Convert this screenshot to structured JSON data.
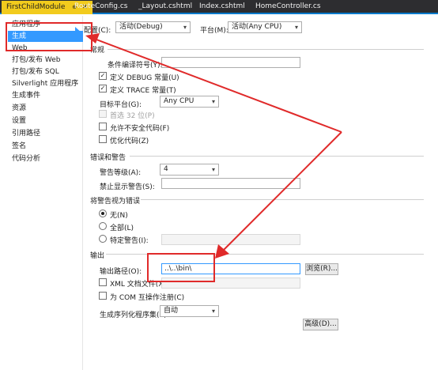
{
  "tabs": [
    {
      "label": "FirstChildModule",
      "pin": "⊕",
      "close": "✕"
    },
    {
      "label": "RouteConfig.cs"
    },
    {
      "label": "_Layout.cshtml"
    },
    {
      "label": "Index.cshtml"
    },
    {
      "label": "HomeController.cs"
    }
  ],
  "nav": {
    "items": [
      "应用程序",
      "生成",
      "Web",
      "打包/发布 Web",
      "打包/发布 SQL",
      "Silverlight 应用程序",
      "生成事件",
      "资源",
      "设置",
      "引用路径",
      "签名",
      "代码分析"
    ],
    "selected_index": 1
  },
  "config_row": {
    "config_label": "配置(C):",
    "config_value": "活动(Debug)",
    "platform_label": "平台(M):",
    "platform_value": "活动(Any CPU)"
  },
  "general": {
    "heading": "常规",
    "conditional_symbols_label": "条件编译符号(Y):",
    "conditional_symbols_value": "",
    "define_debug": "定义 DEBUG 常量(U)",
    "define_trace": "定义 TRACE 常量(T)",
    "platform_target_label": "目标平台(G):",
    "platform_target_value": "Any CPU",
    "prefer_32bit": "首选 32 位(P)",
    "allow_unsafe": "允许不安全代码(F)",
    "optimize": "优化代码(Z)"
  },
  "errors": {
    "heading": "错误和警告",
    "warning_level_label": "警告等级(A):",
    "warning_level_value": "4",
    "suppress_label": "禁止显示警告(S):",
    "suppress_value": ""
  },
  "treat_warnings": {
    "heading": "将警告视为错误",
    "none": "无(N)",
    "all": "全部(L)",
    "specific": "特定警告(I):",
    "specific_value": ""
  },
  "output": {
    "heading": "输出",
    "path_label": "输出路径(O):",
    "path_value": "..\\..\\bin\\",
    "browse": "浏览(R)...",
    "xml_doc": "XML 文档文件(X):",
    "xml_value": "",
    "com_interop": "为 COM 互操作注册(C)",
    "serialization_label": "生成序列化程序集(E):",
    "serialization_value": "自动",
    "advanced": "高级(D)..."
  },
  "checks": {
    "define_debug": true,
    "define_trace": true,
    "prefer_32bit": false,
    "allow_unsafe": false,
    "optimize": false,
    "xml_doc": false,
    "com_interop": false
  },
  "icons": {
    "dropdown": "chevron-down-icon",
    "check": "✓"
  },
  "colors": {
    "accent": "#3399ff",
    "tab_active": "#f2cb1d",
    "annotation": "#e02a2a"
  }
}
